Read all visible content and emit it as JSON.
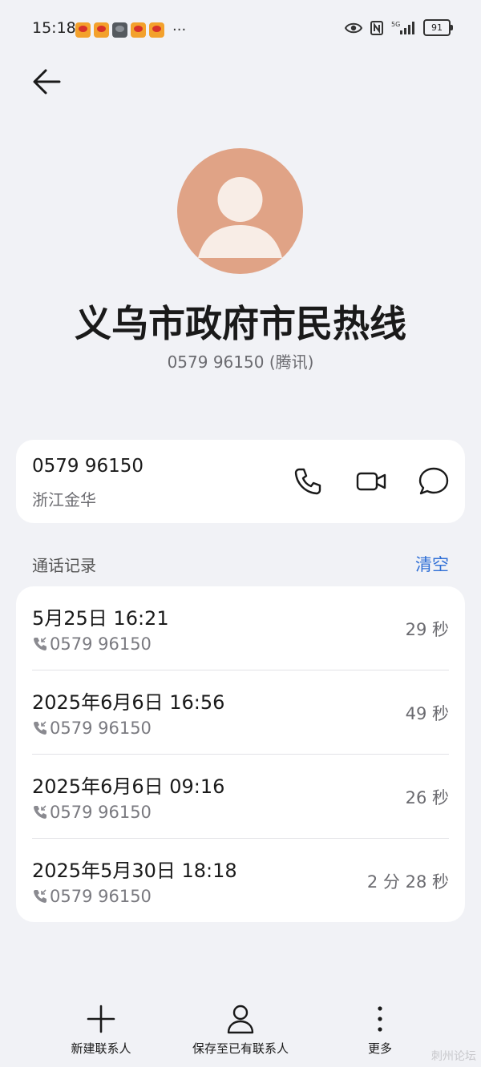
{
  "status_bar": {
    "time": "15:18",
    "more": "···",
    "network": "5G",
    "battery": "91"
  },
  "contact": {
    "name": "义乌市政府市民热线",
    "subtitle": "0579 96150 (腾讯)"
  },
  "number_card": {
    "number": "0579 96150",
    "location": "浙江金华"
  },
  "call_log": {
    "title": "通话记录",
    "clear_label": "清空",
    "entries": [
      {
        "date": "5月25日 16:21",
        "number": "0579 96150",
        "duration": "29 秒"
      },
      {
        "date": "2025年6月6日 16:56",
        "number": "0579 96150",
        "duration": "49 秒"
      },
      {
        "date": "2025年6月6日 09:16",
        "number": "0579 96150",
        "duration": "26 秒"
      },
      {
        "date": "2025年5月30日 18:18",
        "number": "0579 96150",
        "duration": "2 分 28 秒"
      }
    ]
  },
  "bottom_bar": {
    "new_contact": "新建联系人",
    "save_existing": "保存至已有联系人",
    "more": "更多"
  },
  "colors": {
    "accent": "#2f6fd6",
    "avatar": "#e0a386",
    "background": "#f1f2f6"
  },
  "watermark": "刺州论坛"
}
